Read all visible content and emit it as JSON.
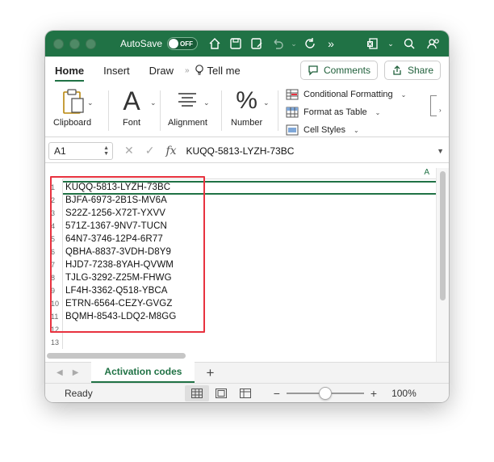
{
  "titlebar": {
    "autosave_label": "AutoSave",
    "toggle_state": "OFF"
  },
  "tabs": {
    "items": [
      "Home",
      "Insert",
      "Draw"
    ],
    "tell_me": "Tell me",
    "comments": "Comments",
    "share": "Share"
  },
  "ribbon": {
    "clipboard": "Clipboard",
    "font": "Font",
    "alignment": "Alignment",
    "number": "Number",
    "conditional_formatting": "Conditional Formatting",
    "format_as_table": "Format as Table",
    "cell_styles": "Cell Styles"
  },
  "formula_bar": {
    "name_box": "A1",
    "fx": "fx",
    "value": "KUQQ-5813-LYZH-73BC"
  },
  "grid": {
    "column_header": "A",
    "rows": [
      {
        "num": "1",
        "value": "KUQQ-5813-LYZH-73BC"
      },
      {
        "num": "2",
        "value": "BJFA-6973-2B1S-MV6A"
      },
      {
        "num": "3",
        "value": "S22Z-1256-X72T-YXVV"
      },
      {
        "num": "4",
        "value": "571Z-1367-9NV7-TUCN"
      },
      {
        "num": "5",
        "value": "64N7-3746-12P4-6R77"
      },
      {
        "num": "6",
        "value": "QBHA-8837-3VDH-D8Y9"
      },
      {
        "num": "7",
        "value": "HJD7-7238-8YAH-QVWM"
      },
      {
        "num": "8",
        "value": "TJLG-3292-Z25M-FHWG"
      },
      {
        "num": "9",
        "value": "LF4H-3362-Q518-YBCA"
      },
      {
        "num": "10",
        "value": "ETRN-6564-CEZY-GVGZ"
      },
      {
        "num": "11",
        "value": "BQMH-8543-LDQ2-M8GG"
      },
      {
        "num": "12",
        "value": ""
      },
      {
        "num": "13",
        "value": ""
      }
    ]
  },
  "sheets": {
    "active_tab": "Activation codes",
    "add": "+"
  },
  "status": {
    "ready": "Ready",
    "zoom_minus": "−",
    "zoom_plus": "+",
    "zoom": "100%",
    "zoom_fraction": 0.5
  },
  "colors": {
    "accent": "#207245",
    "highlight": "#e8323f"
  }
}
